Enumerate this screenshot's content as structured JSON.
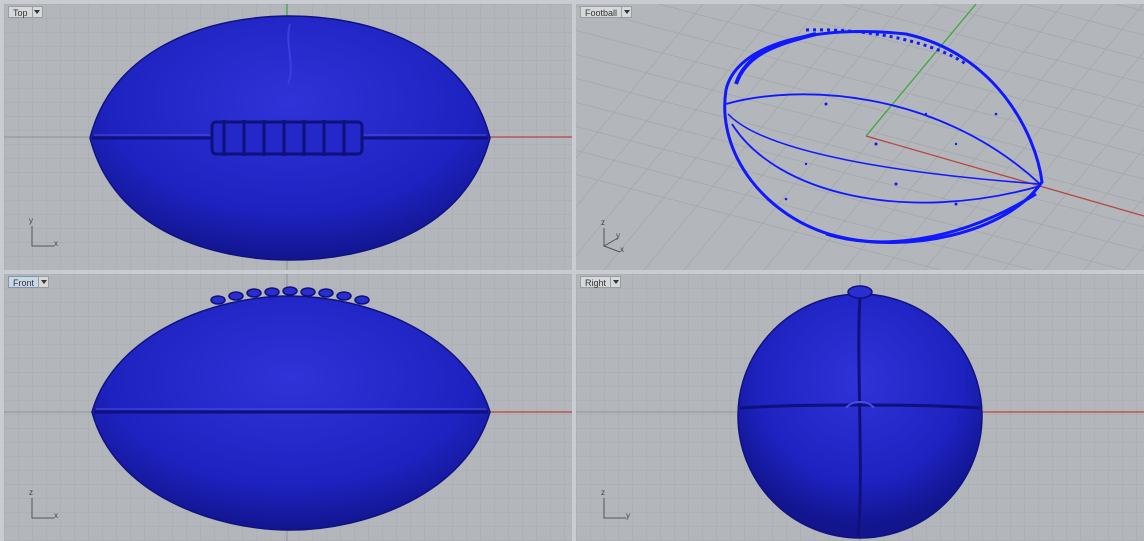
{
  "viewports": {
    "top": {
      "label": "Top",
      "axes": [
        "y",
        "x"
      ]
    },
    "persp": {
      "label": "Football",
      "axes": [
        "z",
        "y",
        "x"
      ]
    },
    "front": {
      "label": "Front",
      "axes": [
        "z",
        "x"
      ]
    },
    "right": {
      "label": "Right",
      "axes": [
        "z",
        "y"
      ]
    }
  },
  "colors": {
    "ball": "#1e22c8",
    "ball_dark": "#10138a",
    "wire": "#1018ff",
    "grid": "#a3a6aa",
    "grid_major": "#8f9296",
    "x_axis": "#b54545",
    "y_axis": "#3ca93c"
  },
  "icons": {
    "viewport_menu": "chevron-down-icon"
  }
}
